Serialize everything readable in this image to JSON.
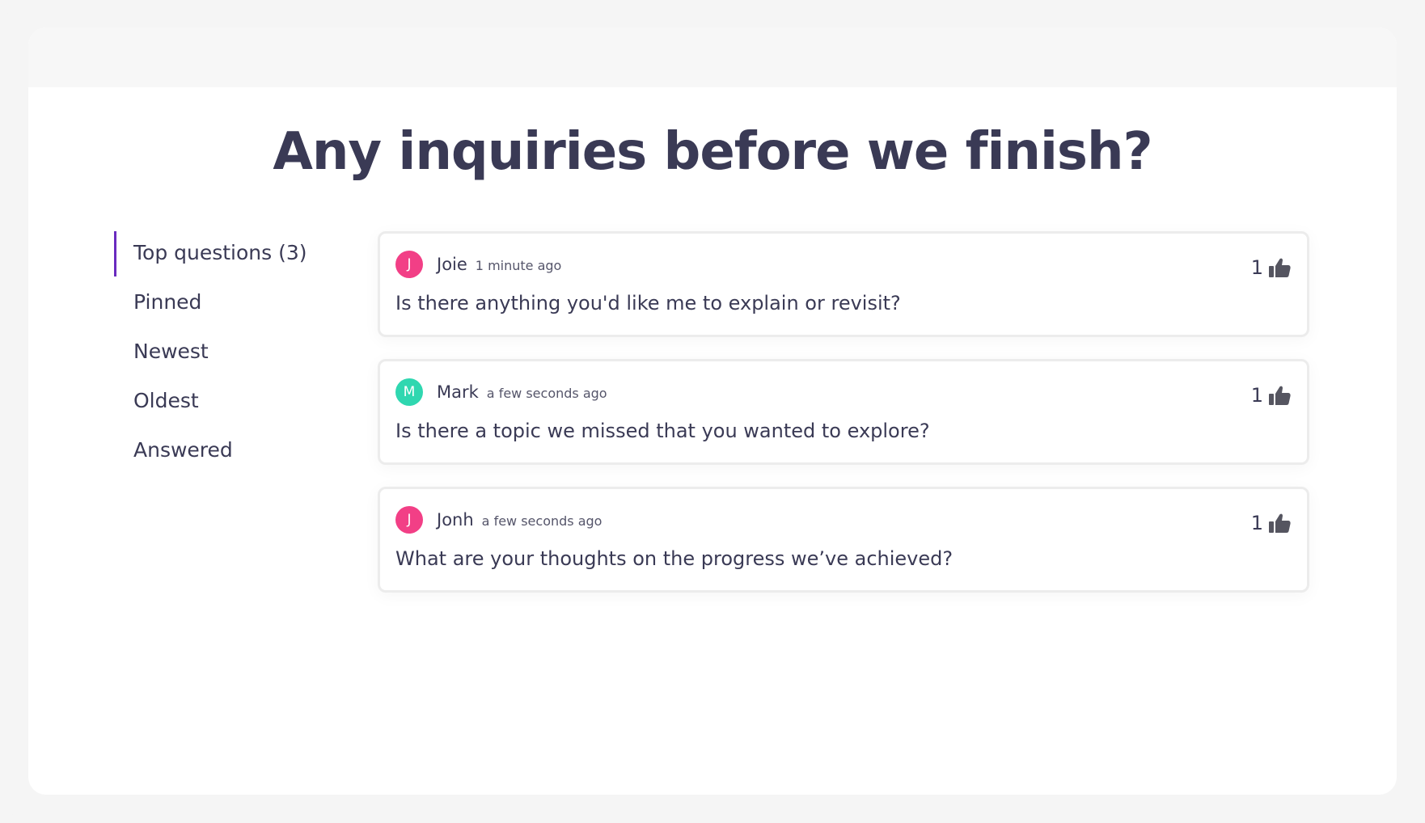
{
  "title": "Any inquiries before we finish?",
  "sidebar": {
    "items": [
      {
        "label": "Top questions (3)",
        "active": true
      },
      {
        "label": "Pinned",
        "active": false
      },
      {
        "label": "Newest",
        "active": false
      },
      {
        "label": "Oldest",
        "active": false
      },
      {
        "label": "Answered",
        "active": false
      }
    ]
  },
  "questions": [
    {
      "initial": "J",
      "author": "Joie",
      "time": "1 minute ago",
      "text": "Is there anything you'd like me to explain or revisit?",
      "votes": "1",
      "avatar_color": "#f23f86",
      "icon": "thumbs-up-icon"
    },
    {
      "initial": "M",
      "author": "Mark",
      "time": "a few seconds ago",
      "text": "Is there a topic we missed that you wanted to explore?",
      "votes": "1",
      "avatar_color": "#2fd7b0",
      "icon": "thumbs-up-icon"
    },
    {
      "initial": "J",
      "author": "Jonh",
      "time": "a few seconds ago",
      "text": "What are your thoughts on the progress we’ve achieved?",
      "votes": "1",
      "avatar_color": "#f23f86",
      "icon": "thumbs-up-icon"
    }
  ],
  "colors": {
    "accent": "#6a2bbf",
    "text": "#3a3a55",
    "background": "#f5f5f5"
  }
}
